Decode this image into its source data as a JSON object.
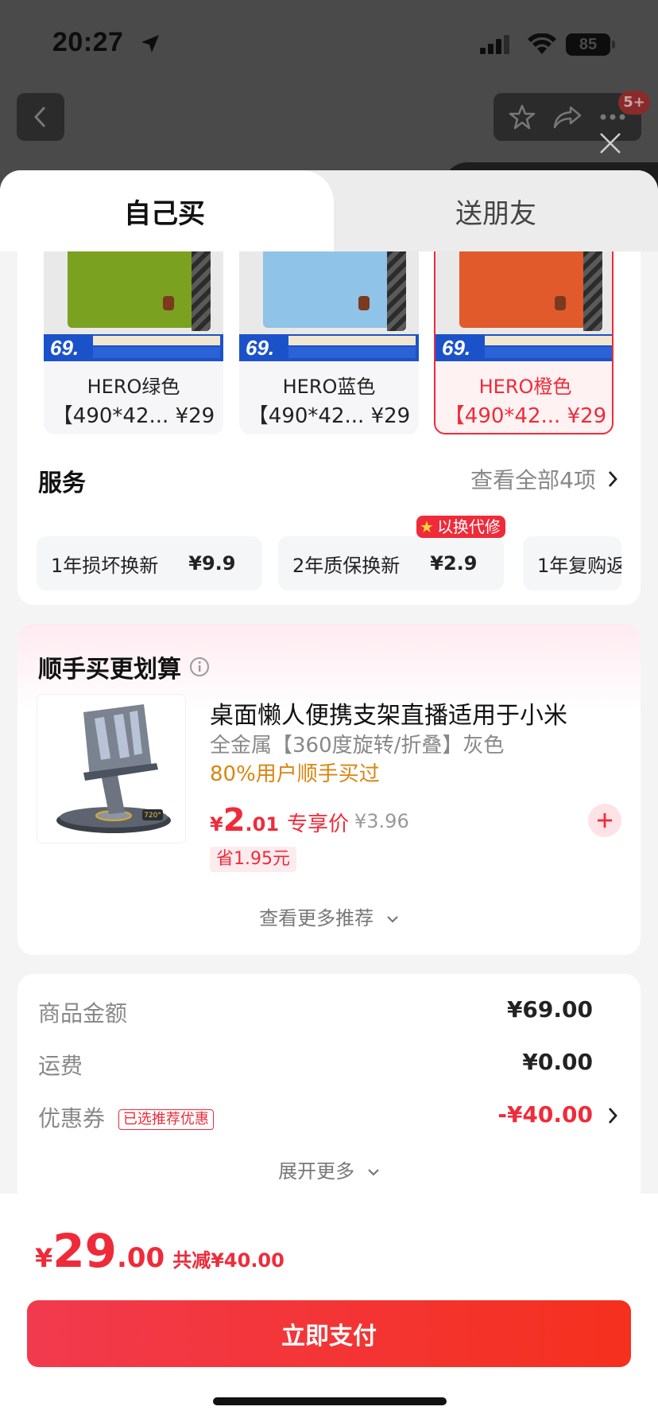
{
  "status_bar": {
    "time": "20:27",
    "battery": "85"
  },
  "header": {
    "notification_badge": "5+"
  },
  "tabs": {
    "active": "自己买",
    "other": "送朋友"
  },
  "variants": [
    {
      "name": "HERO绿色",
      "spec": "【490*42...",
      "price": "¥29",
      "selected": false,
      "color": "#7aa11f",
      "badge_price": "69."
    },
    {
      "name": "HERO蓝色",
      "spec": "【490*42...",
      "price": "¥29",
      "selected": false,
      "color": "#8fc3e7",
      "badge_price": "69."
    },
    {
      "name": "HERO橙色",
      "spec": "【490*42...",
      "price": "¥29",
      "selected": true,
      "color": "#e05a2c",
      "badge_price": "69."
    }
  ],
  "services": {
    "title": "服务",
    "view_all": "查看全部4项",
    "items": [
      {
        "label": "1年损坏换新",
        "price": "¥9.9"
      },
      {
        "label": "2年质保换新",
        "price": "¥2.9"
      },
      {
        "label": "1年复购返",
        "price": ""
      }
    ],
    "badge": "以换代修"
  },
  "addon": {
    "title": "顺手买更划算",
    "product_name": "桌面懒人便携支架直播适用于小米",
    "spec": "全金属【360度旋转/折叠】灰色",
    "rate": "80%用户顺手买过",
    "price_currency": "¥",
    "price_int": "2",
    "price_dec": ".01",
    "price_label": "专享价",
    "original_price": "¥3.96",
    "savings": "省1.95元",
    "more": "查看更多推荐",
    "image_label": "720°"
  },
  "summary": {
    "goods_label": "商品金额",
    "goods_value": "¥69.00",
    "shipping_label": "运费",
    "shipping_value": "¥0.00",
    "coupon_label": "优惠券",
    "coupon_tag": "已选推荐优惠",
    "coupon_value": "-¥40.00",
    "more": "展开更多"
  },
  "footer": {
    "currency": "¥",
    "total_int": "29",
    "total_dec": ".00",
    "discount": "共减¥40.00",
    "pay_button": "立即支付"
  },
  "colors": {
    "accent": "#ef2b3a",
    "rate": "#d8860f"
  }
}
